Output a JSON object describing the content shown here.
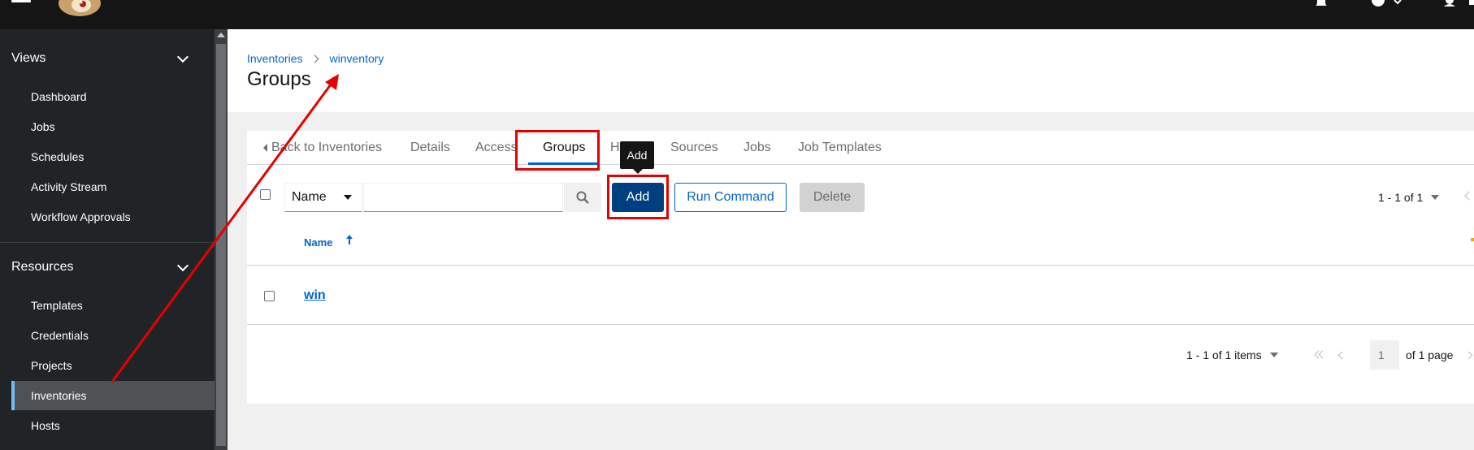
{
  "topbar": {
    "logo_alt": "AWX logo"
  },
  "sidebar": {
    "sections": [
      {
        "label": "Views",
        "items": [
          "Dashboard",
          "Jobs",
          "Schedules",
          "Activity Stream",
          "Workflow Approvals"
        ]
      },
      {
        "label": "Resources",
        "items": [
          "Templates",
          "Credentials",
          "Projects",
          "Inventories",
          "Hosts"
        ]
      }
    ],
    "active_item": "Inventories"
  },
  "breadcrumb": {
    "root": "Inventories",
    "current": "winventory"
  },
  "page_title": "Groups",
  "tabs": [
    "Back to Inventories",
    "Details",
    "Access",
    "Groups",
    "H",
    "Sources",
    "Jobs",
    "Job Templates"
  ],
  "active_tab": "Groups",
  "toolbar": {
    "filter_field": "Name",
    "search_value": "",
    "add_label": "Add",
    "run_command_label": "Run Command",
    "delete_label": "Delete",
    "pagination_top": "1 - 1 of 1"
  },
  "tooltip": "Add",
  "table": {
    "columns": [
      "Name"
    ],
    "sort": "ascending",
    "rows": [
      {
        "name": "win"
      }
    ]
  },
  "pagination_bottom": {
    "summary": "1 - 1 of 1 items",
    "page": "1",
    "of_pages": "of 1 page"
  },
  "colors": {
    "link": "#0066cc",
    "sidebar_bg": "#212427",
    "annotation": "#e60000"
  }
}
